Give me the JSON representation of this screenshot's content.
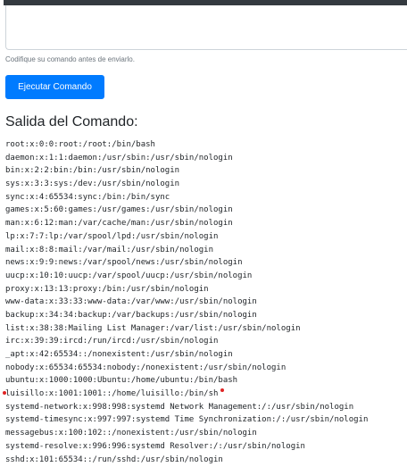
{
  "form": {
    "textarea_value": "",
    "help_text": "Codifique su comando antes de enviarlo.",
    "submit_label": "Ejecutar Comando"
  },
  "output": {
    "title": "Salida del Comando:",
    "lines": [
      "root:x:0:0:root:/root:/bin/bash",
      "daemon:x:1:1:daemon:/usr/sbin:/usr/sbin/nologin",
      "bin:x:2:2:bin:/bin:/usr/sbin/nologin",
      "sys:x:3:3:sys:/dev:/usr/sbin/nologin",
      "sync:x:4:65534:sync:/bin:/bin/sync",
      "games:x:5:60:games:/usr/games:/usr/sbin/nologin",
      "man:x:6:12:man:/var/cache/man:/usr/sbin/nologin",
      "lp:x:7:7:lp:/var/spool/lpd:/usr/sbin/nologin",
      "mail:x:8:8:mail:/var/mail:/usr/sbin/nologin",
      "news:x:9:9:news:/var/spool/news:/usr/sbin/nologin",
      "uucp:x:10:10:uucp:/var/spool/uucp:/usr/sbin/nologin",
      "proxy:x:13:13:proxy:/bin:/usr/sbin/nologin",
      "www-data:x:33:33:www-data:/var/www:/usr/sbin/nologin",
      "backup:x:34:34:backup:/var/backups:/usr/sbin/nologin",
      "list:x:38:38:Mailing List Manager:/var/list:/usr/sbin/nologin",
      "irc:x:39:39:ircd:/run/ircd:/usr/sbin/nologin",
      "_apt:x:42:65534::/nonexistent:/usr/sbin/nologin",
      "nobody:x:65534:65534:nobody:/nonexistent:/usr/sbin/nologin",
      "ubuntu:x:1000:1000:Ubuntu:/home/ubuntu:/bin/bash",
      "luisillo:x:1001:1001::/home/luisillo:/bin/sh",
      "systemd-network:x:998:998:systemd Network Management:/:/usr/sbin/nologin",
      "systemd-timesync:x:997:997:systemd Time Synchronization:/:/usr/sbin/nologin",
      "messagebus:x:100:102::/nonexistent:/usr/sbin/nologin",
      "systemd-resolve:x:996:996:systemd Resolver:/:/usr/sbin/nologin",
      "sshd:x:101:65534::/run/sshd:/usr/sbin/nologin"
    ]
  },
  "colors": {
    "primary_button": "#007bff",
    "annotation_marker": "#e02424"
  }
}
